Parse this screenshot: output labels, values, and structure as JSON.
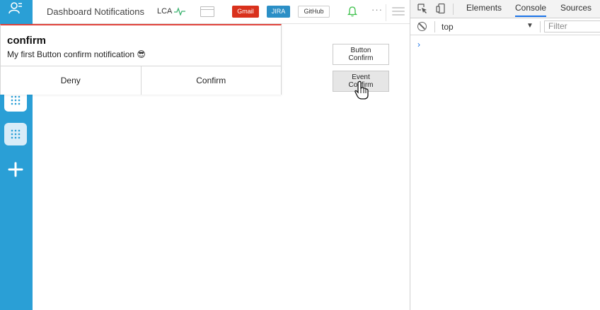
{
  "header": {
    "title": "Dashboard Notifications",
    "lca": "LCA",
    "gmail": "Gmail",
    "jira": "JIRA",
    "github": "GitHub",
    "more": "···"
  },
  "notification": {
    "title": "confirm",
    "message": "My first Button confirm notification 😎",
    "deny_label": "Deny",
    "confirm_label": "Confirm"
  },
  "buttons": {
    "button_confirm": "Button Confirm",
    "event_confirm": "Event Confirm"
  },
  "devtools": {
    "tabs": [
      "Elements",
      "Console",
      "Sources"
    ],
    "active_tab": "Console",
    "context": "top",
    "filter_placeholder": "Filter",
    "prompt": "›"
  },
  "colors": {
    "sidebar": "#2a9fd6",
    "gmail": "#d9311c",
    "jira": "#2b8fc6",
    "notification_accent": "#e0423a",
    "devtools_active": "#1a73e8"
  },
  "icons": [
    "user-icon",
    "apps-grid-icon",
    "plus-icon",
    "pulse-icon",
    "window-icon",
    "bell-icon",
    "menu-icon",
    "inspect-icon",
    "device-icon",
    "block-icon",
    "hand-cursor-icon"
  ]
}
